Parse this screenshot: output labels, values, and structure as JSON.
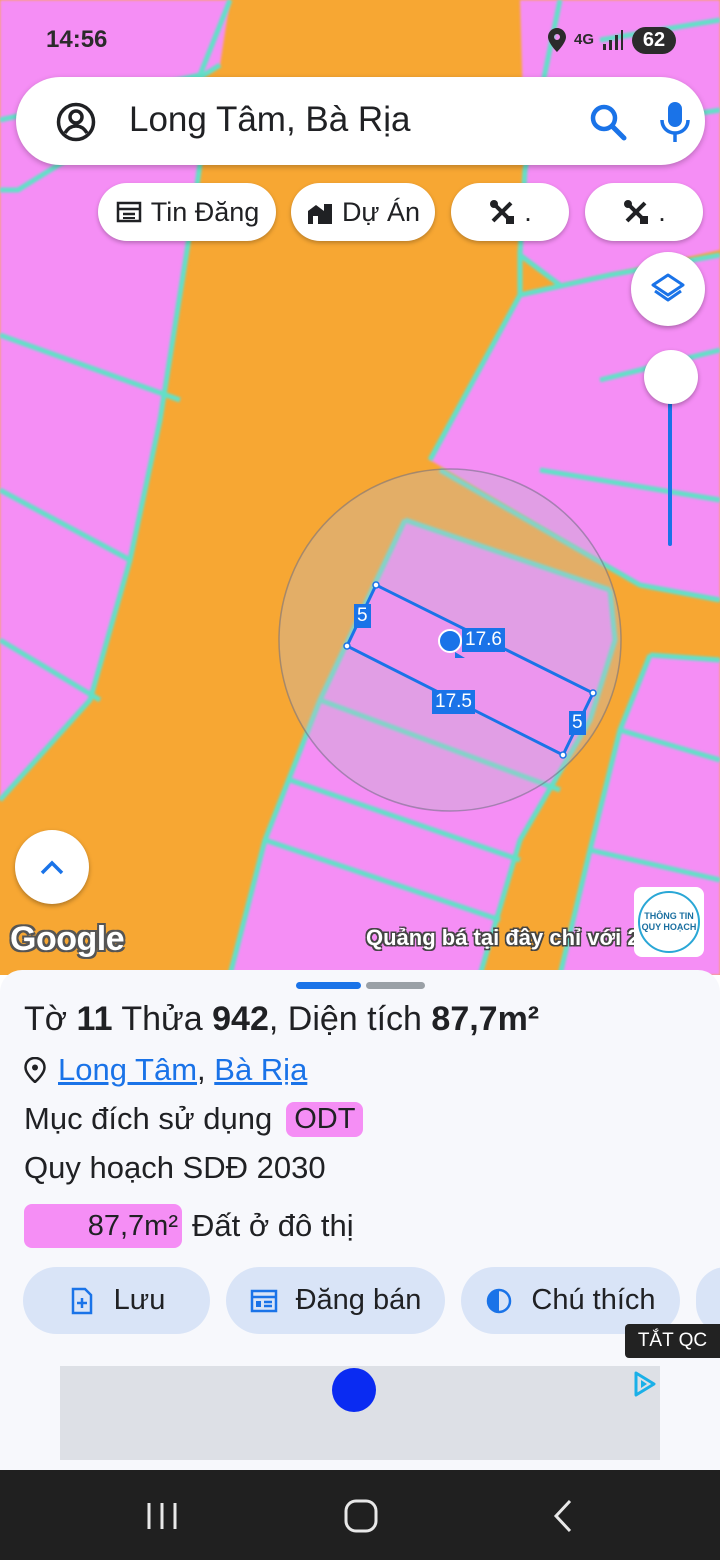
{
  "status_bar": {
    "time": "14:56",
    "network": "4G",
    "battery": "62"
  },
  "search": {
    "query": "Long Tâm, Bà Rịa"
  },
  "chips": [
    {
      "label": "Tin Đăng",
      "icon": "listing-icon"
    },
    {
      "label": "Dự Án",
      "icon": "buildings-icon"
    },
    {
      "label": ".",
      "icon": "tools-icon"
    },
    {
      "label": ".",
      "icon": "tools-icon"
    }
  ],
  "map": {
    "attribution": "Google",
    "promo": "Quảng bá tại đây chỉ với 2030",
    "promo_logo_line1": "THÔNG TIN",
    "promo_logo_line2": "QUY HOẠCH",
    "measurements": {
      "left": "5",
      "top": "17.6",
      "bottom": "17.5",
      "right": "5"
    },
    "colors": {
      "road": "#f7a733",
      "residential": "#f58ef5",
      "boundary": "#62e0c8",
      "parcel_outline": "#1a73e8"
    }
  },
  "parcel": {
    "sheet_label": "Tờ",
    "sheet_no": "11",
    "plot_label": "Thửa",
    "plot_no": "942",
    "area_label": ", Diện tích",
    "area": "87,7m²",
    "ward": "Long Tâm",
    "separator": ",",
    "city": "Bà Rịa",
    "purpose_label": "Mục đích sử dụng",
    "purpose_code": "ODT",
    "plan_label": "Quy hoạch SDĐ 2030",
    "plan_area": "87,7m²",
    "plan_use": "Đất ở đô thị"
  },
  "actions": [
    {
      "label": "Lưu",
      "icon": "save-add-icon"
    },
    {
      "label": "Đăng bán",
      "icon": "post-sale-icon"
    },
    {
      "label": "Chú thích",
      "icon": "legend-icon"
    }
  ],
  "ad": {
    "close_label": "TẮT QC"
  }
}
